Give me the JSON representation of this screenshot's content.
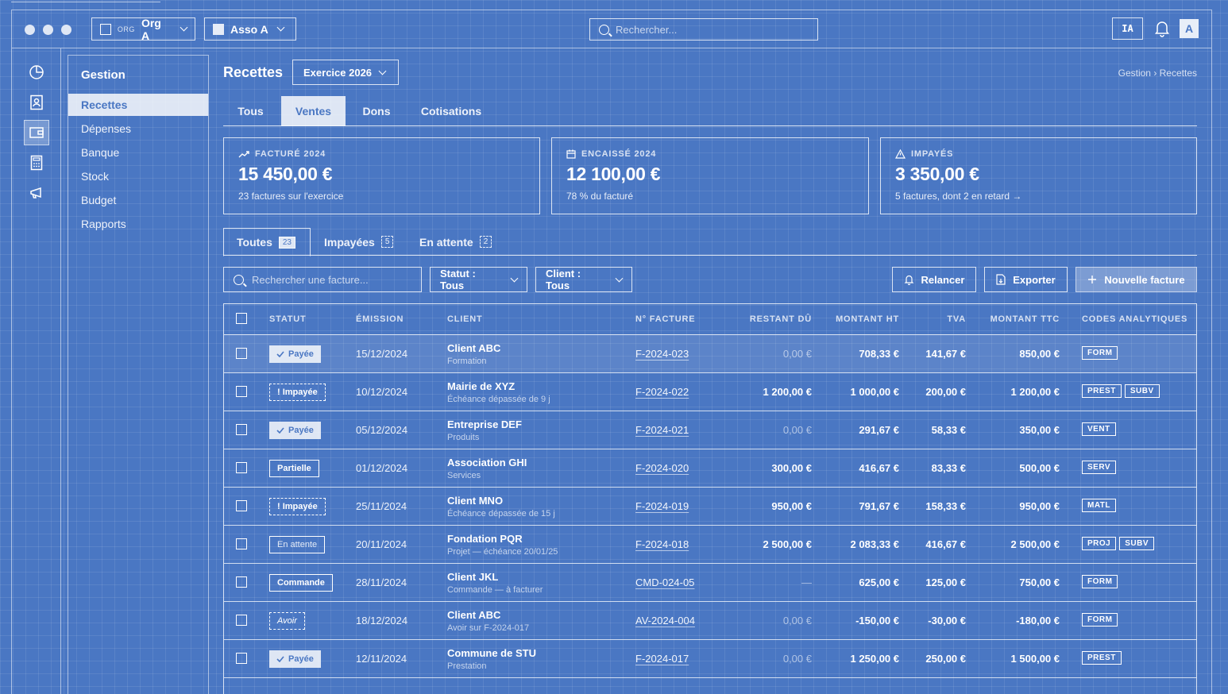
{
  "window": {
    "org_tag": "ORG",
    "org_name": "Org A",
    "asso_name": "Asso A",
    "search_placeholder": "Rechercher...",
    "ia_label": "IA",
    "avatar_initial": "A"
  },
  "sidebar": {
    "title": "Gestion",
    "items": [
      {
        "label": "Recettes"
      },
      {
        "label": "Dépenses"
      },
      {
        "label": "Banque"
      },
      {
        "label": "Stock"
      },
      {
        "label": "Budget"
      },
      {
        "label": "Rapports"
      }
    ]
  },
  "header": {
    "title": "Recettes",
    "exercice": "Exercice 2026",
    "breadcrumb": "Gestion › Recettes"
  },
  "main_tabs": [
    {
      "label": "Tous"
    },
    {
      "label": "Ventes"
    },
    {
      "label": "Dons"
    },
    {
      "label": "Cotisations"
    }
  ],
  "kpis": [
    {
      "label": "FACTURÉ 2024",
      "value": "15 450,00 €",
      "sub": "23 factures sur l'exercice",
      "icon": "trend-icon"
    },
    {
      "label": "ENCAISSÉ 2024",
      "value": "12 100,00 €",
      "sub": "78 % du facturé",
      "icon": "calendar-icon"
    },
    {
      "label": "IMPAYÉS",
      "value": "3 350,00 €",
      "sub": "5 factures, dont 2 en retard →",
      "icon": "warning-icon"
    }
  ],
  "sub_tabs": [
    {
      "label": "Toutes",
      "count": "23"
    },
    {
      "label": "Impayées",
      "count": "5"
    },
    {
      "label": "En attente",
      "count": "2"
    }
  ],
  "filters": {
    "search_placeholder": "Rechercher une facture...",
    "status": "Statut : Tous",
    "client": "Client : Tous"
  },
  "actions": {
    "remind": "Relancer",
    "export": "Exporter",
    "new_invoice": "Nouvelle facture"
  },
  "table": {
    "columns": [
      "STATUT",
      "ÉMISSION",
      "CLIENT",
      "N° FACTURE",
      "RESTANT DÛ",
      "MONTANT HT",
      "TVA",
      "MONTANT TTC",
      "CODES ANALYTIQUES"
    ],
    "rows": [
      {
        "status": "Payée",
        "status_kind": "paid",
        "date": "15/12/2024",
        "client": "Client ABC",
        "client_sub": "Formation",
        "invoice": "F-2024-023",
        "due": "0,00 €",
        "due_dim": true,
        "ht": "708,33 €",
        "tva": "141,67 €",
        "ttc": "850,00 €",
        "codes": [
          "FORM"
        ]
      },
      {
        "status": "! Impayée",
        "status_kind": "unpaid",
        "date": "10/12/2024",
        "client": "Mairie de XYZ",
        "client_sub": "Échéance dépassée de 9 j",
        "invoice": "F-2024-022",
        "due": "1 200,00 €",
        "due_dim": false,
        "ht": "1 000,00 €",
        "tva": "200,00 €",
        "ttc": "1 200,00 €",
        "codes": [
          "PREST",
          "SUBV"
        ]
      },
      {
        "status": "Payée",
        "status_kind": "paid",
        "date": "05/12/2024",
        "client": "Entreprise DEF",
        "client_sub": "Produits",
        "invoice": "F-2024-021",
        "due": "0,00 €",
        "due_dim": true,
        "ht": "291,67 €",
        "tva": "58,33 €",
        "ttc": "350,00 €",
        "codes": [
          "VENT"
        ]
      },
      {
        "status": "Partielle",
        "status_kind": "partial",
        "date": "01/12/2024",
        "client": "Association GHI",
        "client_sub": "Services",
        "invoice": "F-2024-020",
        "due": "300,00 €",
        "due_dim": false,
        "ht": "416,67 €",
        "tva": "83,33 €",
        "ttc": "500,00 €",
        "codes": [
          "SERV"
        ]
      },
      {
        "status": "! Impayée",
        "status_kind": "unpaid",
        "date": "25/11/2024",
        "client": "Client MNO",
        "client_sub": "Échéance dépassée de 15 j",
        "invoice": "F-2024-019",
        "due": "950,00 €",
        "due_dim": false,
        "ht": "791,67 €",
        "tva": "158,33 €",
        "ttc": "950,00 €",
        "codes": [
          "MATL"
        ]
      },
      {
        "status": "En attente",
        "status_kind": "pending",
        "date": "20/11/2024",
        "client": "Fondation PQR",
        "client_sub": "Projet — échéance 20/01/25",
        "invoice": "F-2024-018",
        "due": "2 500,00 €",
        "due_dim": false,
        "ht": "2 083,33 €",
        "tva": "416,67 €",
        "ttc": "2 500,00 €",
        "codes": [
          "PROJ",
          "SUBV"
        ]
      },
      {
        "status": "Commande",
        "status_kind": "order",
        "date": "28/11/2024",
        "client": "Client JKL",
        "client_sub": "Commande — à facturer",
        "invoice": "CMD-024-05",
        "due": "—",
        "due_dim": true,
        "ht": "625,00 €",
        "tva": "125,00 €",
        "ttc": "750,00 €",
        "codes": [
          "FORM"
        ]
      },
      {
        "status": "Avoir",
        "status_kind": "credit",
        "date": "18/12/2024",
        "client": "Client ABC",
        "client_sub": "Avoir sur F-2024-017",
        "invoice": "AV-2024-004",
        "due": "0,00 €",
        "due_dim": true,
        "ht": "-150,00 €",
        "tva": "-30,00 €",
        "ttc": "-180,00 €",
        "codes": [
          "FORM"
        ]
      },
      {
        "status": "Payée",
        "status_kind": "paid",
        "date": "12/11/2024",
        "client": "Commune de STU",
        "client_sub": "Prestation",
        "invoice": "F-2024-017",
        "due": "0,00 €",
        "due_dim": true,
        "ht": "1 250,00 €",
        "tva": "250,00 €",
        "ttc": "1 500,00 €",
        "codes": [
          "PREST"
        ]
      }
    ]
  },
  "colors": {
    "background": "#4a77c3",
    "line": "#ffffff"
  }
}
